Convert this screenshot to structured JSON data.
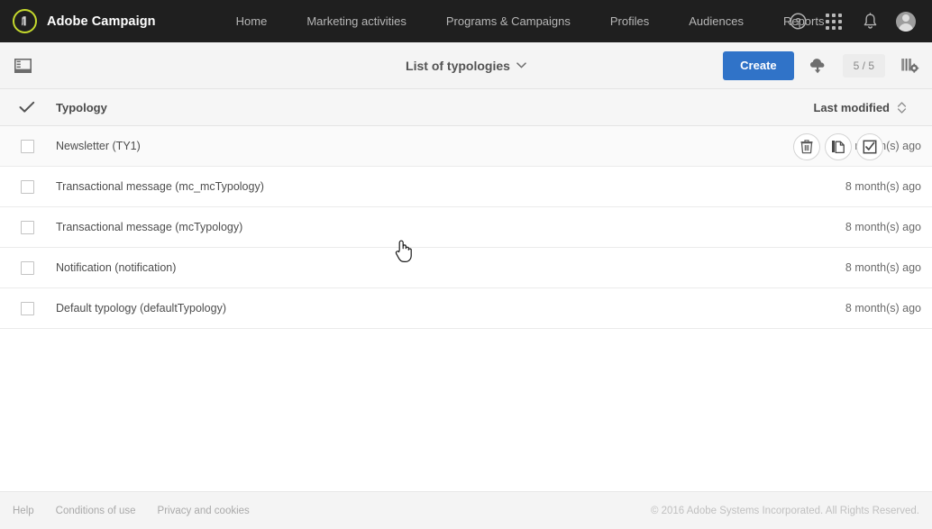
{
  "topnav": {
    "brand": "Adobe Campaign",
    "logo_icon": "adobe-campaign-logo-icon",
    "brand_ring_color": "#c5d92d",
    "background_color": "#1f1f1f",
    "links": [
      {
        "label": "Home"
      },
      {
        "label": "Marketing activities"
      },
      {
        "label": "Programs & Campaigns"
      },
      {
        "label": "Profiles"
      },
      {
        "label": "Audiences"
      },
      {
        "label": "Reports"
      }
    ],
    "icons": [
      {
        "name": "help-icon",
        "glyph": "?"
      },
      {
        "name": "app-grid-icon",
        "glyph": ""
      },
      {
        "name": "notifications-bell-icon",
        "glyph": ""
      },
      {
        "name": "user-avatar-icon",
        "glyph": ""
      }
    ]
  },
  "toolbar": {
    "panel_toggle_icon": "sidebar-toggle-icon",
    "title": "List of typologies",
    "title_chevron_icon": "chevron-down-icon",
    "create_label": "Create",
    "create_color": "#3073c8",
    "download_icon": "cloud-download-icon",
    "count_badge": "5 / 5",
    "columns_icon": "column-settings-icon"
  },
  "table": {
    "columns": {
      "select_all_icon": "checkmark-icon",
      "name": "Typology",
      "modified": "Last modified",
      "sort_icon": "sort-updown-icon"
    },
    "rows": [
      {
        "name": "Newsletter (TY1)",
        "modified": "8 month(s) ago",
        "hovered": true
      },
      {
        "name": "Transactional message (mc_mcTypology)",
        "modified": "8 month(s) ago",
        "hovered": false
      },
      {
        "name": "Transactional message (mcTypology)",
        "modified": "8 month(s) ago",
        "hovered": false
      },
      {
        "name": "Notification (notification)",
        "modified": "8 month(s) ago",
        "hovered": false
      },
      {
        "name": "Default typology (defaultTypology)",
        "modified": "8 month(s) ago",
        "hovered": false
      }
    ],
    "row_actions": [
      {
        "name": "delete-row-button",
        "icon": "trash-icon"
      },
      {
        "name": "duplicate-row-button",
        "icon": "duplicate-icon"
      },
      {
        "name": "select-row-button",
        "icon": "checkbox-checked-icon"
      }
    ]
  },
  "footer": {
    "links": [
      {
        "label": "Help"
      },
      {
        "label": "Conditions of use"
      },
      {
        "label": "Privacy and cookies"
      }
    ],
    "copyright": "© 2016 Adobe Systems Incorporated. All Rights Reserved."
  }
}
